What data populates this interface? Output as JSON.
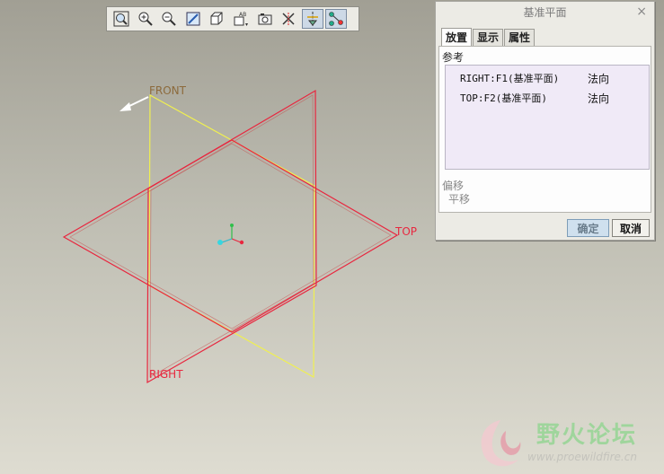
{
  "viewport": {
    "labels": {
      "front": "FRONT",
      "top": "TOP",
      "right": "RIGHT"
    }
  },
  "toolbar": {
    "items": [
      {
        "icon": "refit-icon"
      },
      {
        "icon": "zoom-in-icon"
      },
      {
        "icon": "zoom-out-icon"
      },
      {
        "icon": "repaint-icon"
      },
      {
        "icon": "shading-icon"
      },
      {
        "icon": "saved-views-icon"
      },
      {
        "icon": "camera-icon"
      },
      {
        "icon": "datum-display-icon"
      },
      {
        "icon": "axis-display-icon"
      },
      {
        "icon": "point-display-icon"
      }
    ]
  },
  "dialog": {
    "title": "基准平面",
    "close_glyph": "×",
    "tabs": [
      {
        "label": "放置"
      },
      {
        "label": "显示"
      },
      {
        "label": "属性"
      }
    ],
    "references_label": "参考",
    "references": [
      {
        "name": "RIGHT:F1(基准平面)",
        "type": "法向"
      },
      {
        "name": "TOP:F2(基准平面)",
        "type": "法向"
      }
    ],
    "offset_label": "偏移",
    "offset_value": "平移",
    "ok_label": "确定",
    "cancel_label": "取消"
  },
  "watermark": {
    "title": "野火论坛",
    "url": "www.proewildfire.cn"
  },
  "colors": {
    "front_plane": "#f0f050",
    "selected_plane": "#e8273f",
    "front_label": "#8c6a3c",
    "selected_label": "#e8273f"
  }
}
